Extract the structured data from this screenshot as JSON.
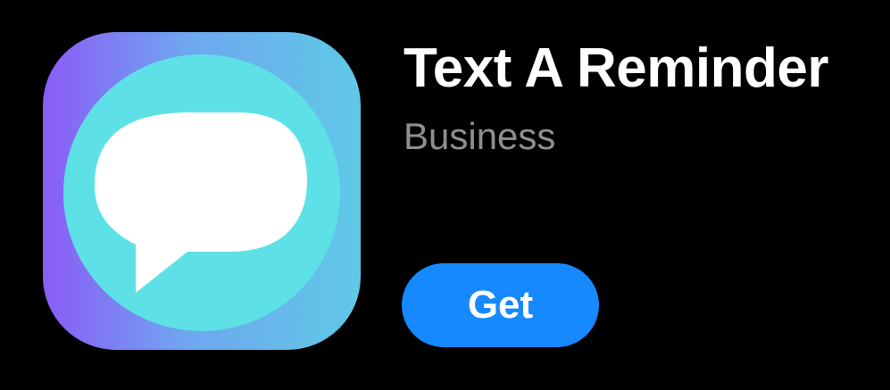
{
  "app": {
    "name": "Text A Reminder",
    "category": "Business",
    "get_label": "Get",
    "icon": "speech-bubble-icon"
  },
  "colors": {
    "background": "#000000",
    "title": "#ffffff",
    "category": "#8e8e93",
    "button": "#1689ff",
    "button_text": "#ffffff",
    "icon_gradient_start": "#8a5cf6",
    "icon_gradient_end": "#5fc4e6",
    "icon_circle": "#5ee1e6",
    "icon_bubble": "#ffffff"
  }
}
